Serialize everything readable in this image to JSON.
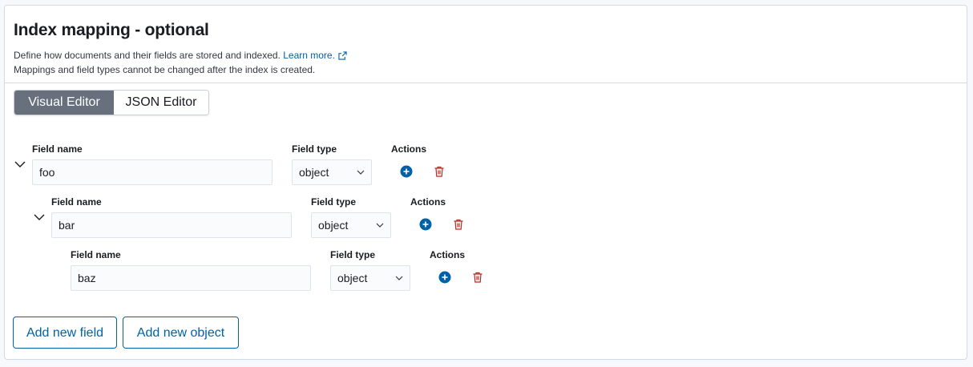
{
  "header": {
    "title": "Index mapping - optional",
    "description": "Define how documents and their fields are stored and indexed.",
    "learn_more": "Learn more.",
    "note": "Mappings and field types cannot be changed after the index is created."
  },
  "tabs": [
    {
      "label": "Visual Editor",
      "active": true
    },
    {
      "label": "JSON Editor",
      "active": false
    }
  ],
  "labels": {
    "field_name": "Field name",
    "field_type": "Field type",
    "actions": "Actions"
  },
  "fields": [
    {
      "name": "foo",
      "type": "object",
      "level": 0
    },
    {
      "name": "bar",
      "type": "object",
      "level": 1
    },
    {
      "name": "baz",
      "type": "object",
      "level": 2
    }
  ],
  "buttons": {
    "add_field": "Add new field",
    "add_object": "Add new object"
  },
  "colors": {
    "accent": "#0061a6",
    "danger": "#bd271e",
    "active_tab": "#69707d"
  }
}
